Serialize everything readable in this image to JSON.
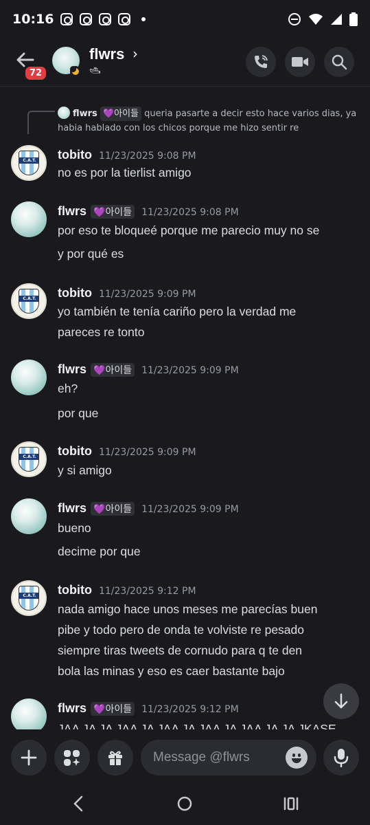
{
  "status_bar": {
    "time": "10:16"
  },
  "header": {
    "back_badge": "72",
    "name": "flwrs",
    "chevron": "›",
    "status_emoji": "🛥"
  },
  "reply_preview": {
    "author": "flwrs",
    "tag": "💜아이들",
    "text": "queria pasarte a decir esto hace varios dias, ya habia hablado con los chicos porque me hizo sentir re"
  },
  "messages": [
    {
      "author": "tobito",
      "timestamp": "11/23/2025 9:08 PM",
      "tag": "",
      "lines": [
        "no es por la tierlist amigo"
      ]
    },
    {
      "author": "flwrs",
      "timestamp": "11/23/2025 9:08 PM",
      "tag": "💜아이들",
      "lines": [
        "por eso te bloqueé porque me parecio muy no se",
        "y por qué es"
      ]
    },
    {
      "author": "tobito",
      "timestamp": "11/23/2025 9:09 PM",
      "tag": "",
      "lines": [
        "yo también te tenía cariño pero la verdad me",
        "pareces re tonto"
      ]
    },
    {
      "author": "flwrs",
      "timestamp": "11/23/2025 9:09 PM",
      "tag": "💜아이들",
      "lines": [
        "eh?",
        "por que"
      ]
    },
    {
      "author": "tobito",
      "timestamp": "11/23/2025 9:09 PM",
      "tag": "",
      "lines": [
        "y si amigo"
      ]
    },
    {
      "author": "flwrs",
      "timestamp": "11/23/2025 9:09 PM",
      "tag": "💜아이들",
      "lines": [
        "bueno",
        "decime por que"
      ]
    },
    {
      "author": "tobito",
      "timestamp": "11/23/2025 9:12 PM",
      "tag": "",
      "lines": [
        "nada amigo hace unos meses me parecías buen",
        "pibe y todo pero de onda te volviste re pesado",
        "siempre tiras tweets de cornudo para q te den",
        "bola las minas y eso es caer bastante bajo"
      ]
    },
    {
      "author": "flwrs",
      "timestamp": "11/23/2025 9:12 PM",
      "tag": "💜아이들",
      "lines": [
        "JAA JA JA JAA JA JAA JA JAA JA JAA JA JA JKASE"
      ]
    }
  ],
  "avatar_badge": {
    "cat": "C.A.T."
  },
  "composer": {
    "placeholder": "Message @flwrs"
  },
  "colors": {
    "background": "#1a1a1e",
    "badge": "#e23d43",
    "tag_heart": "#c089f5"
  }
}
